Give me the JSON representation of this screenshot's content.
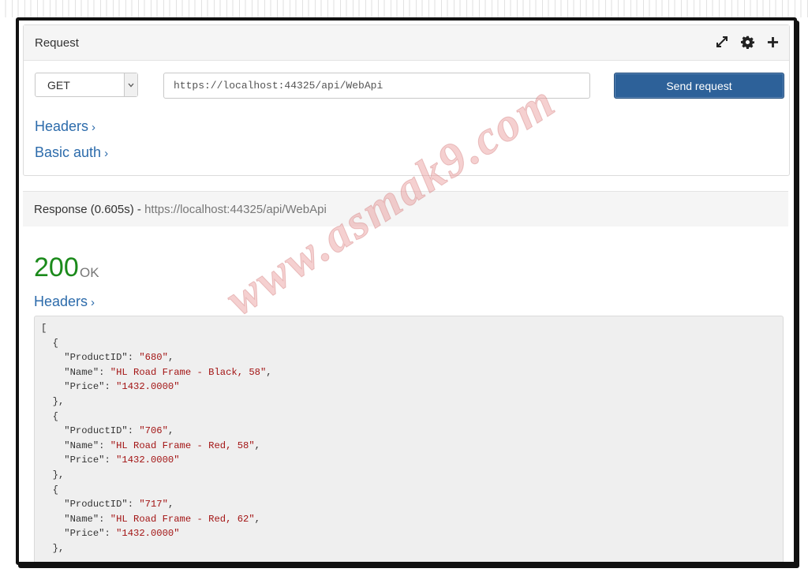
{
  "request": {
    "title": "Request",
    "icons": [
      "expand-icon",
      "gear-icon",
      "plus-icon"
    ],
    "method": "GET",
    "url": "https://localhost:44325/api/WebApi",
    "send_label": "Send request",
    "headers_link": "Headers",
    "basic_auth_link": "Basic auth"
  },
  "response": {
    "title_prefix": "Response (0.605s) -",
    "url": "https://localhost:44325/api/WebApi",
    "status_code": "200",
    "status_text": "OK",
    "headers_link": "Headers",
    "items": [
      {
        "ProductID": "680",
        "Name": "HL Road Frame - Black, 58",
        "Price": "1432.0000"
      },
      {
        "ProductID": "706",
        "Name": "HL Road Frame - Red, 58",
        "Price": "1432.0000"
      },
      {
        "ProductID": "717",
        "Name": "HL Road Frame - Red, 62",
        "Price": "1432.0000"
      }
    ]
  },
  "watermark": "www.asmak9.com",
  "colors": {
    "accent": "#2d6199",
    "link": "#2c6bab",
    "status_ok": "#1b8a1b",
    "string": "#a31515"
  }
}
